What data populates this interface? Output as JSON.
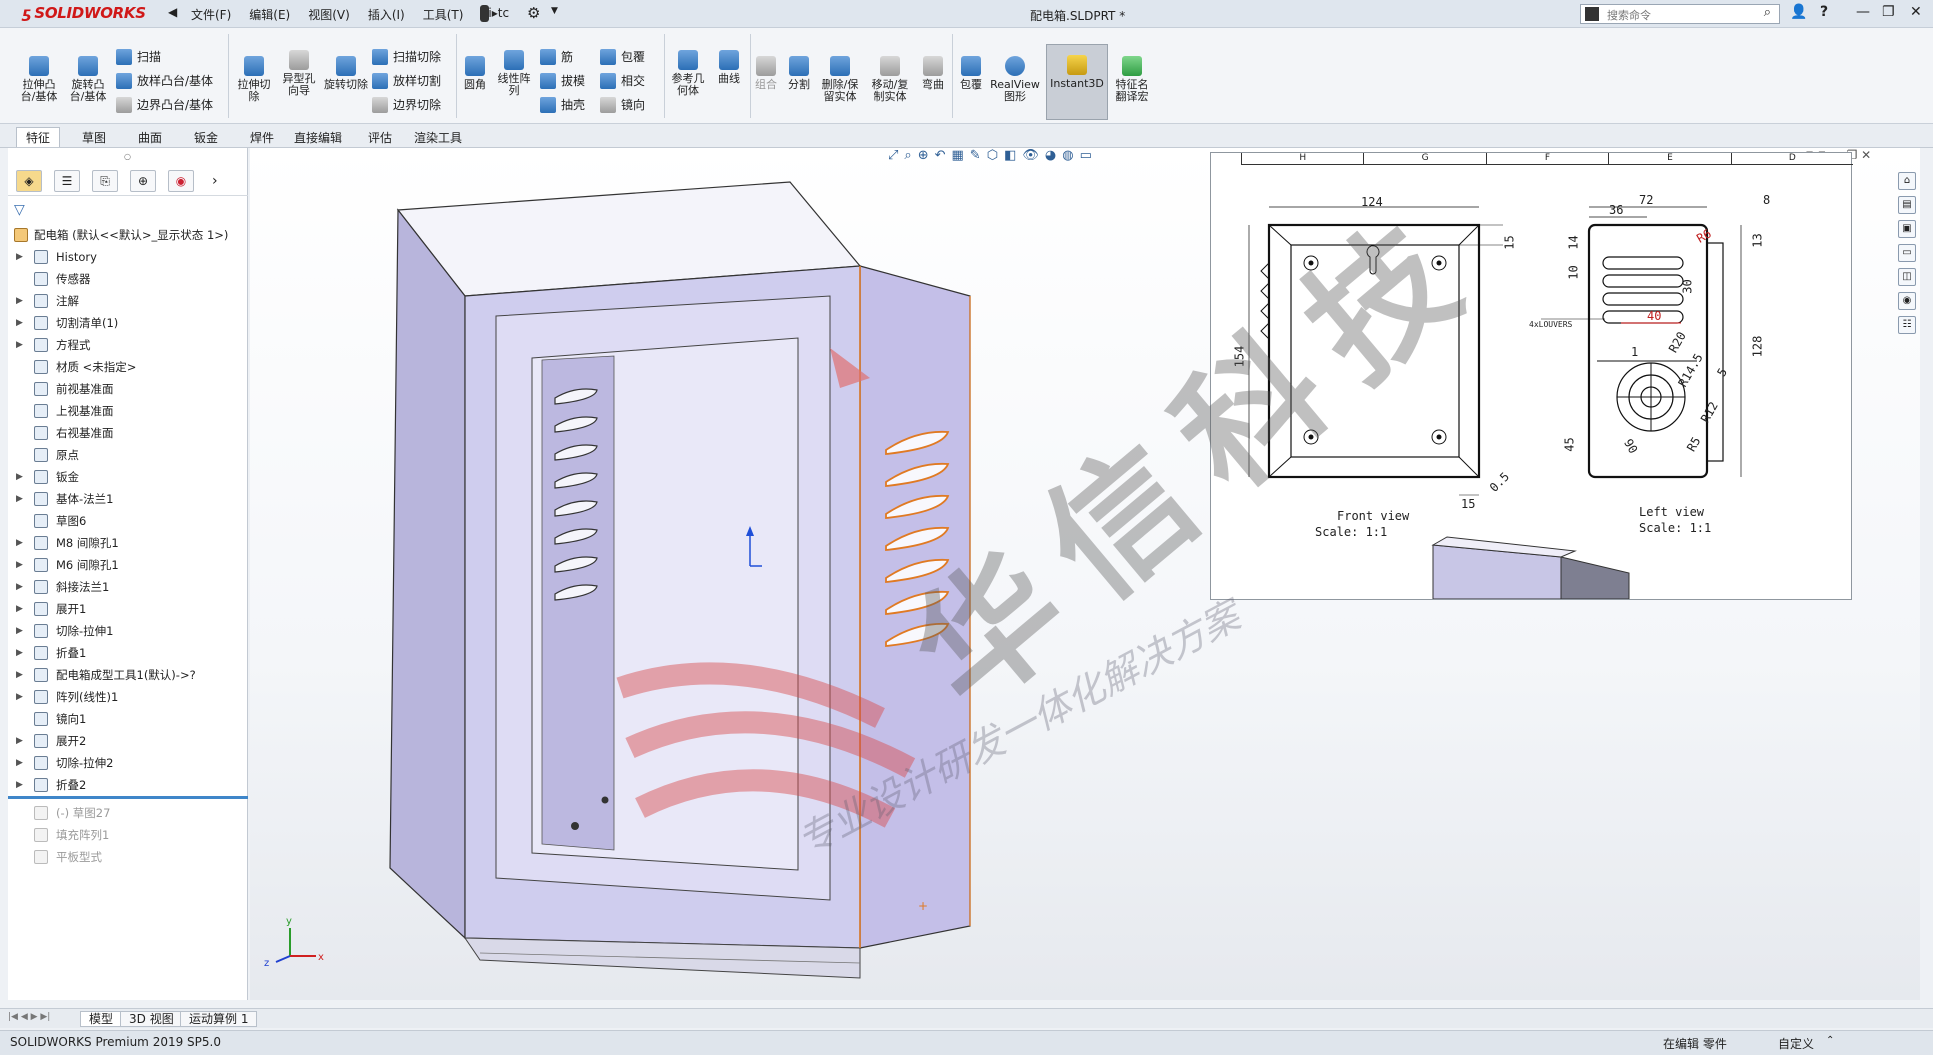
{
  "app": {
    "logo": "SOLIDWORKS",
    "menus": [
      "文件(F)",
      "编辑(E)",
      "视图(V)",
      "插入(I)",
      "工具(T)",
      "Pi▸tc"
    ],
    "document_title": "配电箱.SLDPRT *",
    "search_placeholder": "搜索命令"
  },
  "toolbar": {
    "extrude_boss": "拉伸凸台/基体",
    "revolve_boss": "旋转凸台/基体",
    "sweep": "扫描",
    "loft_boss": "放样凸台/基体",
    "boundary_boss": "边界凸台/基体",
    "extrude_cut": "拉伸切除",
    "hole_wizard": "异型孔向导",
    "revolve_cut": "旋转切除",
    "sweep_cut": "扫描切除",
    "loft_cut": "放样切割",
    "boundary_cut": "边界切除",
    "fillet": "圆角",
    "linear_pattern": "线性阵列",
    "rib": "筋",
    "draft": "拔模",
    "shell": "抽壳",
    "wrap": "包覆",
    "intersect": "相交",
    "mirror": "镜向",
    "ref_geometry": "参考几何体",
    "curves": "曲线",
    "combine": "组合",
    "split": "分割",
    "delete_keep": "删除/保留实体",
    "move_copy": "移动/复制实体",
    "flex": "弯曲",
    "wrap2": "包覆",
    "realview": "RealView图形",
    "instant3d": "Instant3D",
    "feature_translate": "特征名翻译宏"
  },
  "tabs": [
    "特征",
    "草图",
    "曲面",
    "钣金",
    "焊件",
    "直接编辑",
    "评估",
    "渲染工具"
  ],
  "tree": {
    "root": "配电箱 (默认<<默认>_显示状态 1>)",
    "items": [
      {
        "label": "History",
        "expand": true
      },
      {
        "label": "传感器",
        "expand": false
      },
      {
        "label": "注解",
        "expand": true
      },
      {
        "label": "切割清单(1)",
        "expand": true
      },
      {
        "label": "方程式",
        "expand": true
      },
      {
        "label": "材质 <未指定>",
        "expand": false
      },
      {
        "label": "前视基准面",
        "expand": false
      },
      {
        "label": "上视基准面",
        "expand": false
      },
      {
        "label": "右视基准面",
        "expand": false
      },
      {
        "label": "原点",
        "expand": false
      },
      {
        "label": "钣金",
        "expand": true
      },
      {
        "label": "基体-法兰1",
        "expand": true
      },
      {
        "label": "草图6",
        "expand": false
      },
      {
        "label": "M8 间隙孔1",
        "expand": true
      },
      {
        "label": "M6 间隙孔1",
        "expand": true
      },
      {
        "label": "斜接法兰1",
        "expand": true
      },
      {
        "label": "展开1",
        "expand": true
      },
      {
        "label": "切除-拉伸1",
        "expand": true
      },
      {
        "label": "折叠1",
        "expand": true
      },
      {
        "label": "配电箱成型工具1(默认)->?",
        "expand": true
      },
      {
        "label": "阵列(线性)1",
        "expand": true
      },
      {
        "label": "镜向1",
        "expand": false
      },
      {
        "label": "展开2",
        "expand": true
      },
      {
        "label": "切除-拉伸2",
        "expand": true
      },
      {
        "label": "折叠2",
        "expand": true
      }
    ],
    "suppressed": [
      "(-) 草图27",
      "填充阵列1",
      "平板型式"
    ]
  },
  "drawing": {
    "ruler": [
      "H",
      "G",
      "F",
      "E",
      "D"
    ],
    "front_label": "Front view",
    "front_scale": "Scale:  1:1",
    "left_label": "Left view",
    "left_scale": "Scale:  1:1",
    "dims": {
      "w124": "124",
      "h154": "154",
      "d15a": "15",
      "d15b": "15",
      "d05": "0.5",
      "w72": "72",
      "w36": "36",
      "w8": "8",
      "r6": "R6",
      "d13": "13",
      "d14": "14",
      "d10": "10",
      "d30": "30",
      "d40": "40",
      "louvers": "4xLOUVERS",
      "r20": "R20",
      "d1": "1",
      "r145": "R14.5",
      "d5": "5",
      "d128": "128",
      "r12": "R12",
      "d45": "45",
      "d90": "90",
      "r5": "R5"
    }
  },
  "watermark": {
    "main": "华信科技",
    "sub": "专业设计研发一体化解决方案"
  },
  "bottom_tabs": [
    "模型",
    "3D 视图",
    "运动算例 1"
  ],
  "status": {
    "left": "SOLIDWORKS Premium 2019 SP5.0",
    "mid": "在编辑 零件",
    "right": "自定义"
  },
  "colors": {
    "accent": "#3f86c9",
    "model_face": "#c3bfe6",
    "model_light": "#dcdcf4",
    "watermark_red": "#d84a4a"
  }
}
